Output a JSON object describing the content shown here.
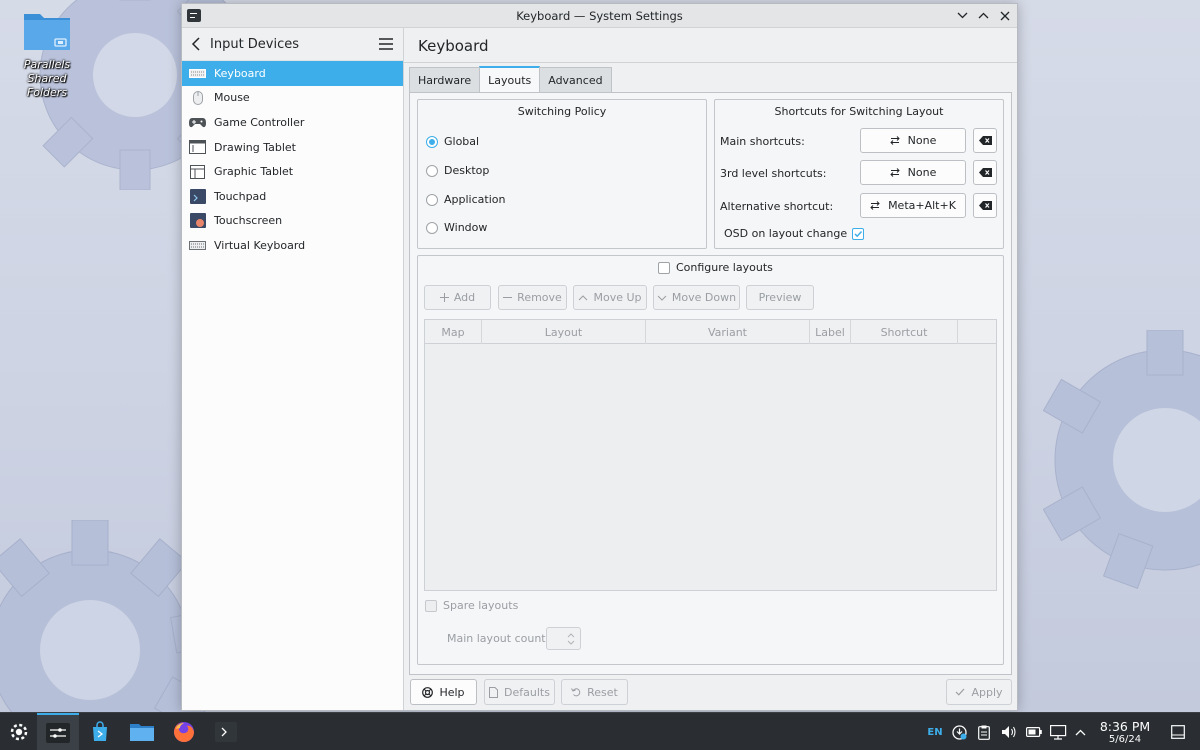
{
  "desktop": {
    "icon_label_line1": "Parallels Shared",
    "icon_label_line2": "Folders"
  },
  "window": {
    "title": "Keyboard — System Settings"
  },
  "sidebar": {
    "title": "Input Devices",
    "items": [
      {
        "label": "Keyboard",
        "icon": "keyboard-icon",
        "active": true
      },
      {
        "label": "Mouse",
        "icon": "mouse-icon"
      },
      {
        "label": "Game Controller",
        "icon": "gamepad-icon"
      },
      {
        "label": "Drawing Tablet",
        "icon": "drawing-tablet-icon"
      },
      {
        "label": "Graphic Tablet",
        "icon": "graphic-tablet-icon"
      },
      {
        "label": "Touchpad",
        "icon": "touchpad-icon"
      },
      {
        "label": "Touchscreen",
        "icon": "touchscreen-icon"
      },
      {
        "label": "Virtual Keyboard",
        "icon": "virtual-keyboard-icon"
      }
    ]
  },
  "main": {
    "title": "Keyboard",
    "tabs": [
      "Hardware",
      "Layouts",
      "Advanced"
    ],
    "active_tab": "Layouts"
  },
  "switching_policy": {
    "title": "Switching Policy",
    "options": [
      "Global",
      "Desktop",
      "Application",
      "Window"
    ],
    "selected": "Global"
  },
  "shortcuts": {
    "title": "Shortcuts for Switching Layout",
    "main_label": "Main shortcuts:",
    "main_value": "None",
    "third_label": "3rd level shortcuts:",
    "third_value": "None",
    "alt_label": "Alternative shortcut:",
    "alt_value": "Meta+Alt+K",
    "osd_label": "OSD on layout change",
    "osd_checked": true
  },
  "layouts": {
    "configure_label": "Configure layouts",
    "configure_checked": false,
    "buttons": {
      "add": "Add",
      "remove": "Remove",
      "move_up": "Move Up",
      "move_down": "Move Down",
      "preview": "Preview"
    },
    "columns": [
      "Map",
      "Layout",
      "Variant",
      "Label",
      "Shortcut"
    ],
    "rows": [],
    "spare_label": "Spare layouts",
    "main_count_label": "Main layout count:"
  },
  "footer": {
    "help": "Help",
    "defaults": "Defaults",
    "reset": "Reset",
    "apply": "Apply"
  },
  "taskbar": {
    "keyboard_layout": "EN",
    "time": "8:36 PM",
    "date": "5/6/24"
  },
  "colors": {
    "accent": "#3daee9",
    "panel": "#2a2e32",
    "window_bg": "#eff0f1"
  }
}
